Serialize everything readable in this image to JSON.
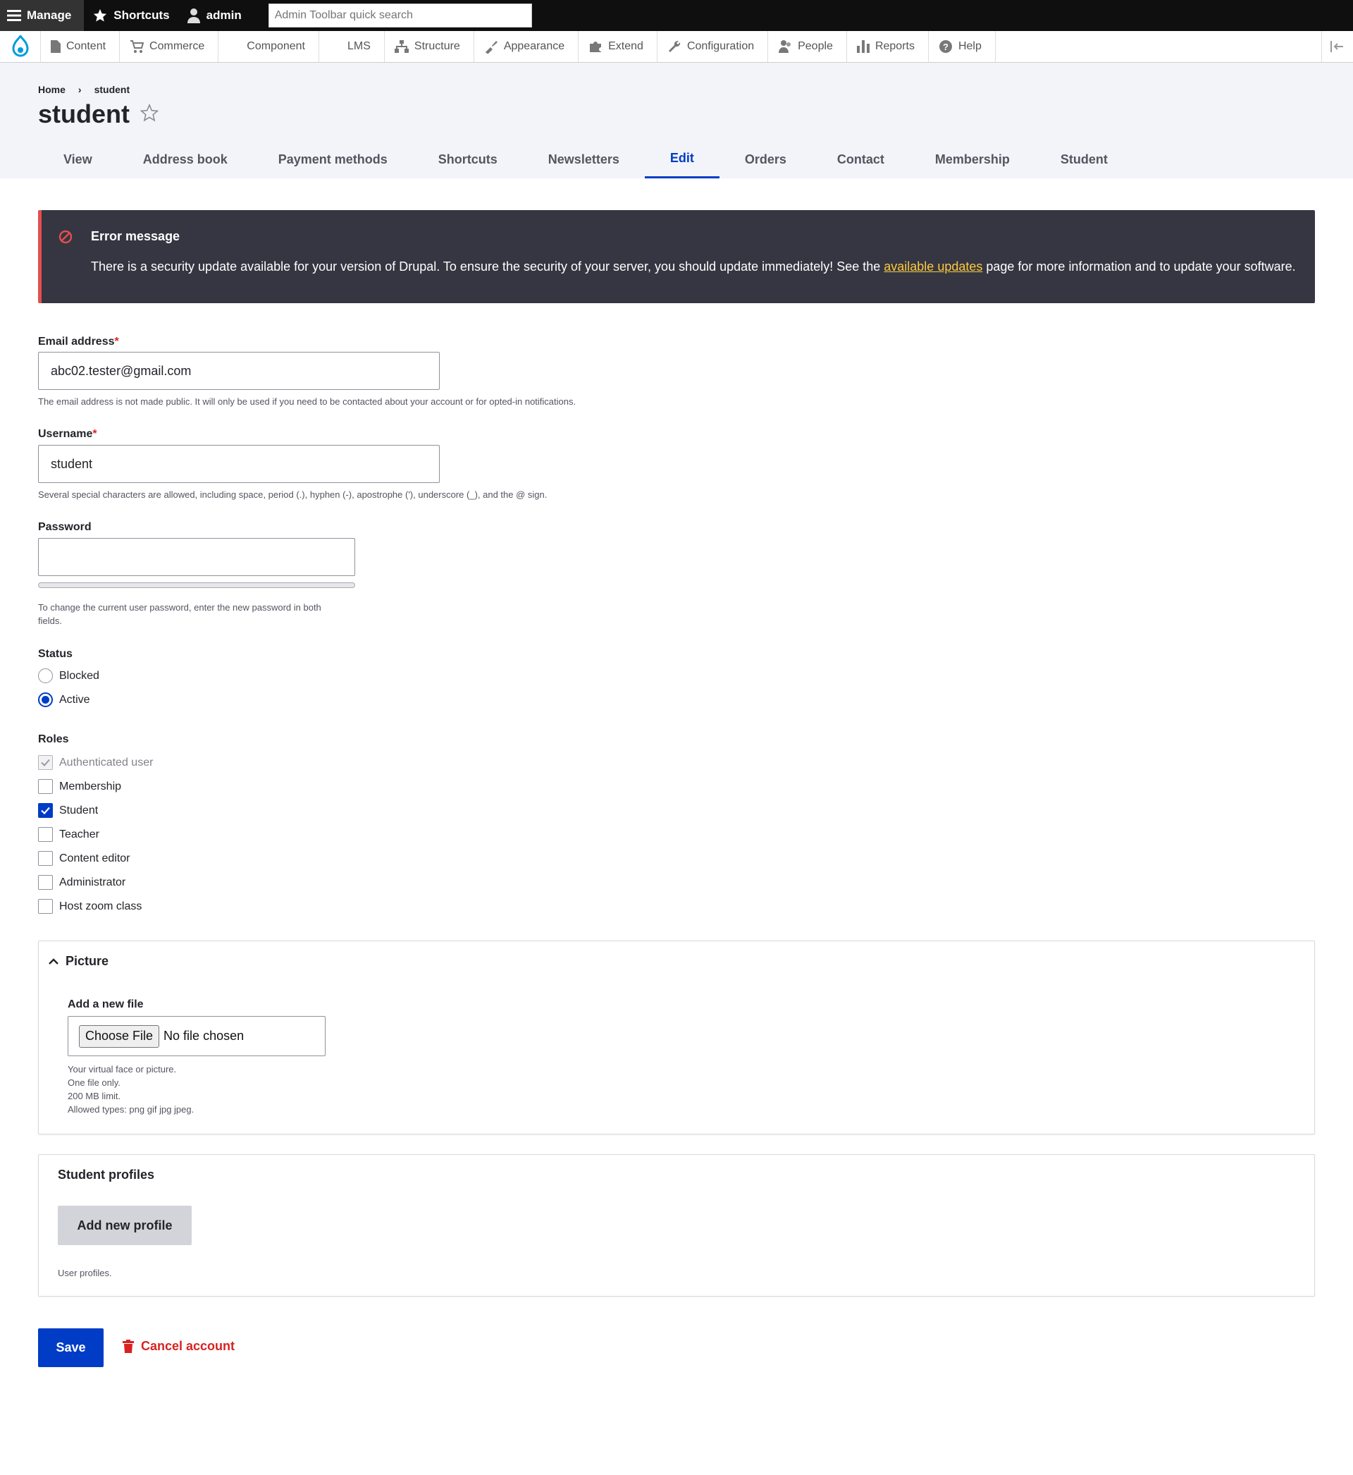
{
  "toolbar": {
    "manage": "Manage",
    "shortcuts": "Shortcuts",
    "user": "admin",
    "search_placeholder": "Admin Toolbar quick search"
  },
  "menu": {
    "items": [
      "Content",
      "Commerce",
      "Component",
      "LMS",
      "Structure",
      "Appearance",
      "Extend",
      "Configuration",
      "People",
      "Reports",
      "Help"
    ]
  },
  "breadcrumb": [
    "Home",
    "student"
  ],
  "page": {
    "title": "student"
  },
  "tabs": [
    "View",
    "Address book",
    "Payment methods",
    "Shortcuts",
    "Newsletters",
    "Edit",
    "Orders",
    "Contact",
    "Membership",
    "Student"
  ],
  "error": {
    "title": "Error message",
    "text_before": "There is a security update available for your version of Drupal. To ensure the security of your server, you should update immediately! See the ",
    "link": "available updates",
    "text_after": " page for more information and to update your software."
  },
  "email": {
    "label": "Email address",
    "required_mark": "*",
    "value": "abc02.tester@gmail.com",
    "description": "The email address is not made public. It will only be used if you need to be contacted about your account or for opted-in notifications."
  },
  "username": {
    "label": "Username",
    "required_mark": "*",
    "value": "student",
    "description": "Several special characters are allowed, including space, period (.), hyphen (-), apostrophe ('), underscore (_), and the @ sign."
  },
  "password": {
    "label": "Password",
    "value": "",
    "description_line1": "To change the current user password, enter the new password in both",
    "description_line2": "fields."
  },
  "status": {
    "label": "Status",
    "options": [
      "Blocked",
      "Active"
    ],
    "selected": "Active"
  },
  "roles": {
    "label": "Roles",
    "options": [
      {
        "label": "Authenticated user",
        "checked": true,
        "disabled": true
      },
      {
        "label": "Membership",
        "checked": false
      },
      {
        "label": "Student",
        "checked": true
      },
      {
        "label": "Teacher",
        "checked": false
      },
      {
        "label": "Content editor",
        "checked": false
      },
      {
        "label": "Administrator",
        "checked": false
      },
      {
        "label": "Host zoom class",
        "checked": false
      }
    ]
  },
  "picture": {
    "title": "Picture",
    "file_label": "Add a new file",
    "choose_button": "Choose File",
    "no_file": "No file chosen",
    "help": [
      "Your virtual face or picture.",
      "One file only.",
      "200 MB limit.",
      "Allowed types: png gif jpg jpeg."
    ]
  },
  "profiles": {
    "title": "Student profiles",
    "add_button": "Add new profile",
    "description": "User profiles."
  },
  "actions": {
    "save": "Save",
    "cancel": "Cancel account"
  },
  "colors": {
    "accent": "#003cc5",
    "error_border": "#e34f4f",
    "error_bg": "#353641",
    "link_yellow": "#fdca40",
    "danger": "#d72222"
  }
}
